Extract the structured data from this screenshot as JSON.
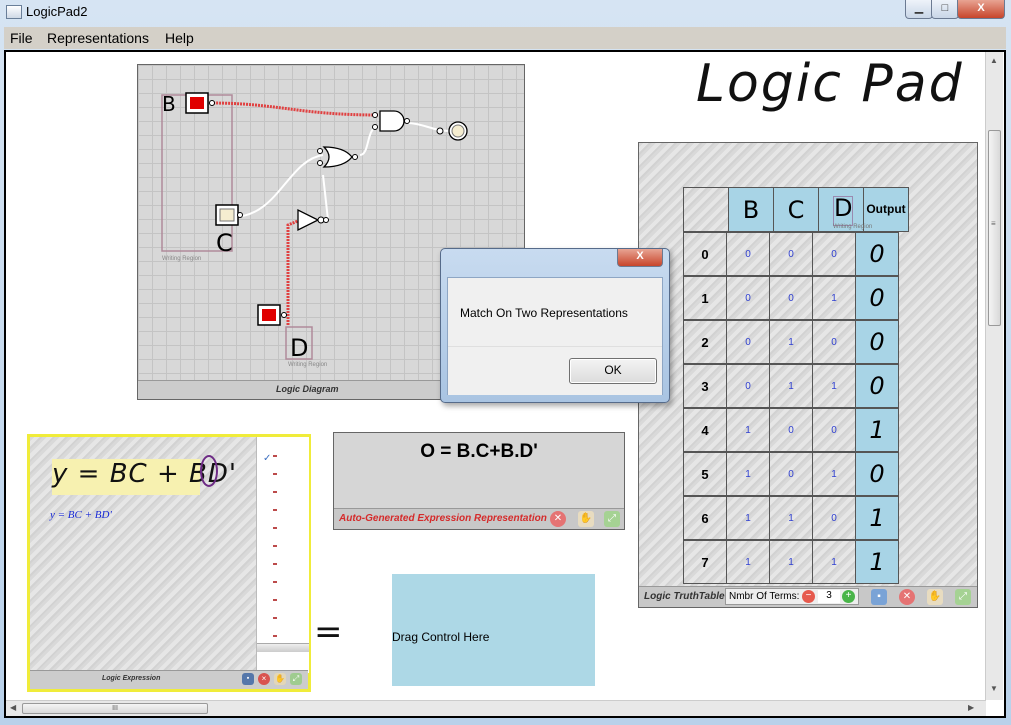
{
  "window": {
    "title": "LogicPad2",
    "minimize": "▁",
    "maximize": "□",
    "close": "X"
  },
  "menu": [
    "File",
    "Representations",
    "Help"
  ],
  "header_title": "Logic Pad",
  "diagram": {
    "footer": "Logic Diagram",
    "inputs": [
      {
        "label": "B"
      },
      {
        "label": "C"
      },
      {
        "label": "D"
      }
    ],
    "writing_region": "Writing Region"
  },
  "expression_ink": {
    "ink": "y = BC + BD'",
    "recognized": "y = BC + BD'",
    "footer": "Logic Expression"
  },
  "auto_expression": {
    "text": "O = B.C+B.D'",
    "footer": "Auto-Generated Expression Representation"
  },
  "equals_sign": "=",
  "drag_area": {
    "text": "Drag Control Here"
  },
  "truth_table": {
    "headers": [
      "B",
      "C",
      "D"
    ],
    "output_header": "Output",
    "writing_region": "Writing Region",
    "rows": [
      {
        "index": "0",
        "values": [
          "0",
          "0",
          "0"
        ],
        "output": "0"
      },
      {
        "index": "1",
        "values": [
          "0",
          "0",
          "1"
        ],
        "output": "0"
      },
      {
        "index": "2",
        "values": [
          "0",
          "1",
          "0"
        ],
        "output": "0"
      },
      {
        "index": "3",
        "values": [
          "0",
          "1",
          "1"
        ],
        "output": "0"
      },
      {
        "index": "4",
        "values": [
          "1",
          "0",
          "0"
        ],
        "output": "1"
      },
      {
        "index": "5",
        "values": [
          "1",
          "0",
          "1"
        ],
        "output": "0"
      },
      {
        "index": "6",
        "values": [
          "1",
          "1",
          "0"
        ],
        "output": "1"
      },
      {
        "index": "7",
        "values": [
          "1",
          "1",
          "1"
        ],
        "output": "1"
      }
    ],
    "footer": "Logic TruthTable",
    "terms_label": "Nmbr Of Terms:",
    "terms_value": "3"
  },
  "dialog": {
    "message": "Match On Two Representations",
    "ok": "OK",
    "close": "X"
  },
  "scrollbar": {
    "grip": "≡",
    "hgrip": "III"
  },
  "colors": {
    "red_input": "#e00000",
    "table_blue": "#a8d4e6",
    "drag_blue": "#add8e6",
    "expr_red": "#d52b2b",
    "ink_highlight": "#f7f1b0"
  }
}
